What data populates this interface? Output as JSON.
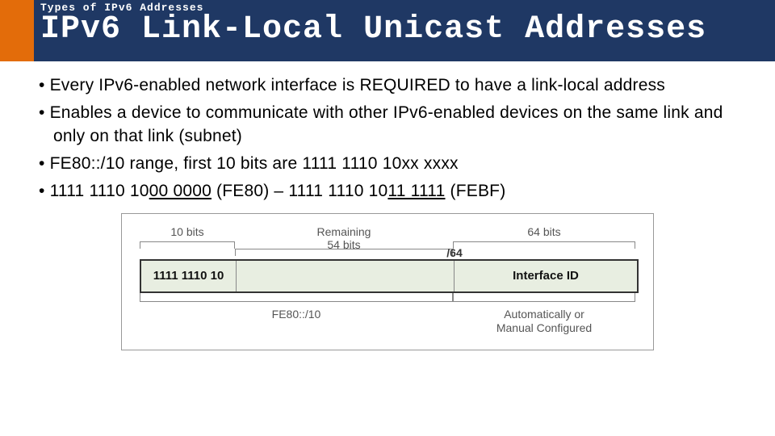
{
  "header": {
    "eyebrow": "Types of IPv6 Addresses",
    "title": "IPv6 Link-Local Unicast Addresses"
  },
  "bullets": {
    "b1": "Every IPv6-enabled network interface is REQUIRED to have a link-local address",
    "b2": "Enables a device to communicate with other IPv6-enabled devices on the same link and only on that link (subnet)",
    "b3": "FE80::/10 range, first 10 bits are 1111 1110 10xx xxxx",
    "b4a": "1111 1110 10",
    "b4b": "00 0000",
    "b4c": " (FE80) – 1111 1110 10",
    "b4d": "11 1111",
    "b4e": " (FEBF)"
  },
  "diagram": {
    "top": {
      "seg1": "10 bits",
      "seg2a": "Remaining",
      "seg2b": "54 bits",
      "seg3": "64 bits"
    },
    "slash64": "/64",
    "bar": {
      "seg1": "1111 1110 10",
      "seg2": "",
      "seg3": "Interface ID"
    },
    "bottom": {
      "seg12": "FE80::/10",
      "seg3a": "Automatically or",
      "seg3b": "Manual Configured"
    }
  }
}
